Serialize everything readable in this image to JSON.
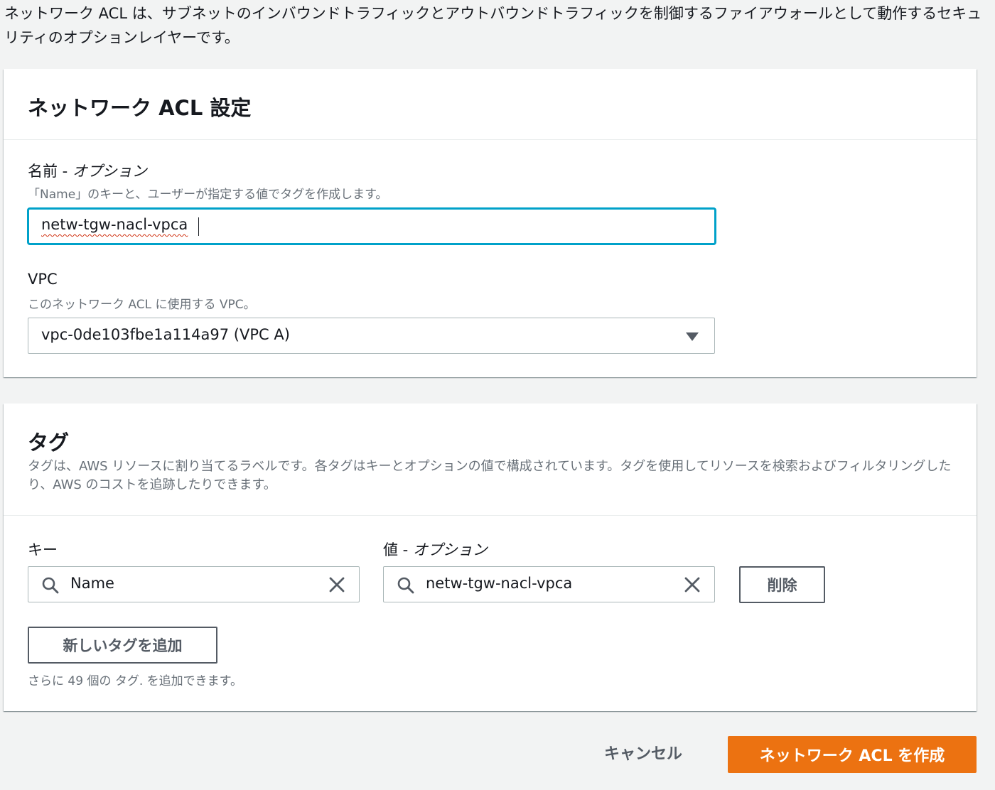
{
  "intro": "ネットワーク ACL は、サブネットのインバウンドトラフィックとアウトバウンドトラフィックを制御するファイアウォールとして動作するセキュリティのオプションレイヤーです。",
  "settings": {
    "title": "ネットワーク ACL 設定",
    "name_label": "名前 - ",
    "name_optional": "オプション",
    "name_desc": "「Name」のキーと、ユーザーが指定する値でタグを作成します。",
    "name_value": "netw-tgw-nacl-vpca",
    "vpc_label": "VPC",
    "vpc_desc": "このネットワーク ACL に使用する VPC。",
    "vpc_value": "vpc-0de103fbe1a114a97 (VPC A)"
  },
  "tags": {
    "title": "タグ",
    "desc": "タグは、AWS リソースに割り当てるラベルです。各タグはキーとオプションの値で構成されています。タグを使用してリソースを検索およびフィルタリングしたり、AWS のコストを追跡したりできます。",
    "key_label": "キー",
    "value_label": "値 - ",
    "value_optional": "オプション",
    "key_value": "Name",
    "value_value": "netw-tgw-nacl-vpca",
    "remove_label": "削除",
    "add_label": "新しいタグを追加",
    "remaining": "さらに 49 個の タグ. を追加できます。"
  },
  "footer": {
    "cancel_label": "キャンセル",
    "create_label": "ネットワーク ACL を作成"
  },
  "colors": {
    "primary": "#ec7211",
    "focus": "#00a1c9"
  },
  "icons": [
    "search-icon",
    "clear-icon",
    "dropdown-arrow-icon"
  ]
}
